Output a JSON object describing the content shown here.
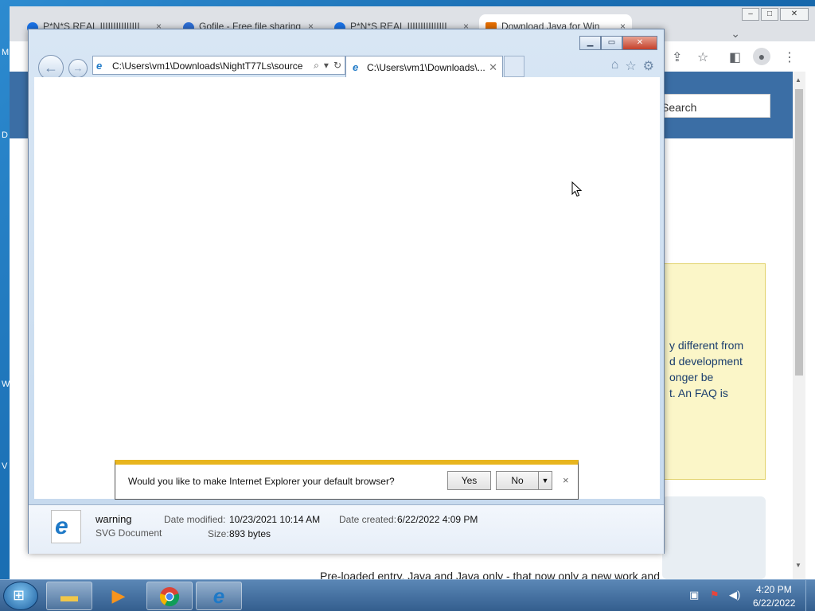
{
  "desktop": {
    "edge_letters": [
      "M",
      "D",
      "W",
      "V"
    ]
  },
  "chrome": {
    "tabs": [
      {
        "label": "P*N*S REAL IIIIIIIIIIIIIII",
        "close": "×"
      },
      {
        "label": "Gofile - Free file sharing",
        "close": "×"
      },
      {
        "label": "P*N*S REAL IIIIIIIIIIIIIII",
        "close": "×"
      },
      {
        "label": "Download Java for Win",
        "close": "×"
      }
    ],
    "new_tab": "+",
    "tab_dropdown": "⌄",
    "window_buttons": {
      "minimize": "–",
      "maximize": "□",
      "close": "✕"
    },
    "toolbar_icons": [
      "share-icon",
      "star-icon",
      "sidepanel-icon",
      "profile-icon",
      "menu-icon"
    ],
    "search_placeholder": "Search",
    "notice_text": "y different from\nd development\nonger be\nt. An FAQ is",
    "bottom_text": "Pre-loaded entry. Java and Java only - that now only a new work and",
    "scroll_up": "▲",
    "scroll_down": "▼"
  },
  "ie": {
    "window_buttons": {
      "minimize": "▁",
      "maximize": "▭",
      "close": "✕"
    },
    "address": "C:\\Users\\vm1\\Downloads\\NightT77Ls\\source",
    "address_icons": {
      "search": "⌕",
      "dropdown": "▾",
      "refresh": "↻"
    },
    "tab_label": "C:\\Users\\vm1\\Downloads\\...",
    "tab_close": "✕",
    "right_icons": {
      "home": "⌂",
      "favorites": "☆",
      "tools": "⚙"
    },
    "notification": {
      "text": "Would you like to make Internet Explorer your default browser?",
      "yes": "Yes",
      "no": "No",
      "dropdown": "▼",
      "close": "×"
    },
    "details": {
      "name": "warning",
      "type": "SVG Document",
      "modified_label": "Date modified:",
      "modified_value": "10/23/2021 10:14 AM",
      "size_label": "Size:",
      "size_value": "893 bytes",
      "created_label": "Date created:",
      "created_value": "6/22/2022 4:09 PM"
    }
  },
  "taskbar": {
    "pinned": [
      "explorer-icon",
      "media-player-icon",
      "chrome-icon",
      "internet-explorer-icon"
    ],
    "tray_icons": [
      "network-icon",
      "action-center-flag-icon",
      "volume-icon"
    ],
    "time": "4:20 PM",
    "date": "6/22/2022"
  }
}
